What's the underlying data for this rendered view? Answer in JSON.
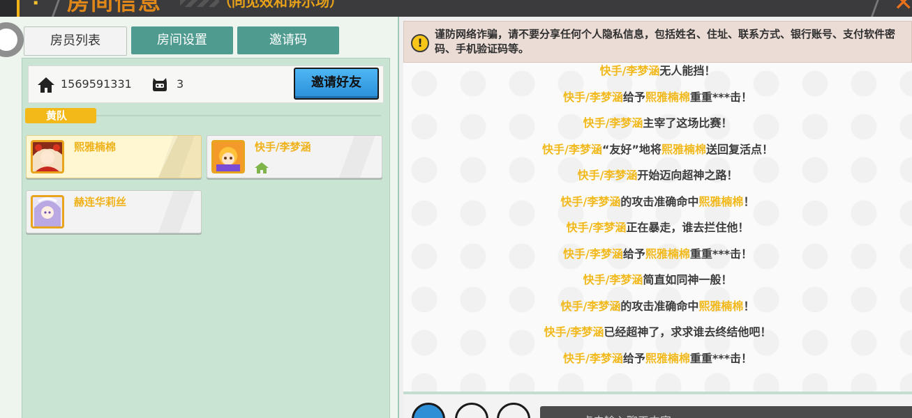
{
  "topbar": {
    "title": "房间信息",
    "subtitle": "（同见效和讲示场）",
    "question_mark": "?",
    "close_glyph": "✕"
  },
  "tabs": [
    {
      "label": "房员列表",
      "active": true
    },
    {
      "label": "房间设置",
      "active": false
    },
    {
      "label": "邀请码",
      "active": false
    }
  ],
  "room": {
    "id": "1569591331",
    "player_count": "3",
    "invite_label": "邀请好友"
  },
  "team": {
    "label": "黄队"
  },
  "players": [
    {
      "name": "熙雅楠棉",
      "is_me": true,
      "is_host": false
    },
    {
      "name": "快手/李梦涵",
      "is_me": false,
      "is_host": true
    },
    {
      "name": "赫连华莉丝",
      "is_me": false,
      "is_host": false
    }
  ],
  "notice": {
    "text": "谨防网络诈骗，请不要分享任何个人隐私信息，包括姓名、住址、联系方式、银行账号、支付软件密码、手机验证码等。"
  },
  "chat": {
    "lines": [
      [
        {
          "t": "快手/李梦涵",
          "h": true
        },
        {
          "t": "无人能挡！",
          "h": false
        }
      ],
      [
        {
          "t": "快手/李梦涵",
          "h": true
        },
        {
          "t": "给予",
          "h": false
        },
        {
          "t": "熙雅楠棉",
          "h": true
        },
        {
          "t": "重重***击！",
          "h": false
        }
      ],
      [
        {
          "t": "快手/李梦涵",
          "h": true
        },
        {
          "t": "主宰了这场比赛！",
          "h": false
        }
      ],
      [
        {
          "t": "快手/李梦涵",
          "h": true
        },
        {
          "t": "“友好”地将",
          "h": false
        },
        {
          "t": "熙雅楠棉",
          "h": true
        },
        {
          "t": "送回复活点！",
          "h": false
        }
      ],
      [
        {
          "t": "快手/李梦涵",
          "h": true
        },
        {
          "t": "开始迈向超神之路！",
          "h": false
        }
      ],
      [
        {
          "t": "快手/李梦涵",
          "h": true
        },
        {
          "t": "的攻击准确命中",
          "h": false
        },
        {
          "t": "熙雅楠棉",
          "h": true
        },
        {
          "t": "！",
          "h": false
        }
      ],
      [
        {
          "t": "快手/李梦涵",
          "h": true
        },
        {
          "t": "正在暴走，谁去拦住他！",
          "h": false
        }
      ],
      [
        {
          "t": "快手/李梦涵",
          "h": true
        },
        {
          "t": "给予",
          "h": false
        },
        {
          "t": "熙雅楠棉",
          "h": true
        },
        {
          "t": "重重***击！",
          "h": false
        }
      ],
      [
        {
          "t": "快手/李梦涵",
          "h": true
        },
        {
          "t": "简直如同神一般！",
          "h": false
        }
      ],
      [
        {
          "t": "快手/李梦涵",
          "h": true
        },
        {
          "t": "的攻击准确命中",
          "h": false
        },
        {
          "t": "熙雅楠棉",
          "h": true
        },
        {
          "t": "！",
          "h": false
        }
      ],
      [
        {
          "t": "快手/李梦涵",
          "h": true
        },
        {
          "t": "已经超神了，求求谁去终结他吧！",
          "h": false
        }
      ],
      [
        {
          "t": "快手/李梦涵",
          "h": true
        },
        {
          "t": "给予",
          "h": false
        },
        {
          "t": "熙雅楠棉",
          "h": true
        },
        {
          "t": "重重***击！",
          "h": false
        }
      ]
    ],
    "input_placeholder": "点击输入聊天内容"
  },
  "colors": {
    "highlight": "#f2b91c",
    "team_yellow": "#f2b918",
    "tab_teal": "#4f9b90",
    "invite_blue": "#2a8fd8"
  }
}
